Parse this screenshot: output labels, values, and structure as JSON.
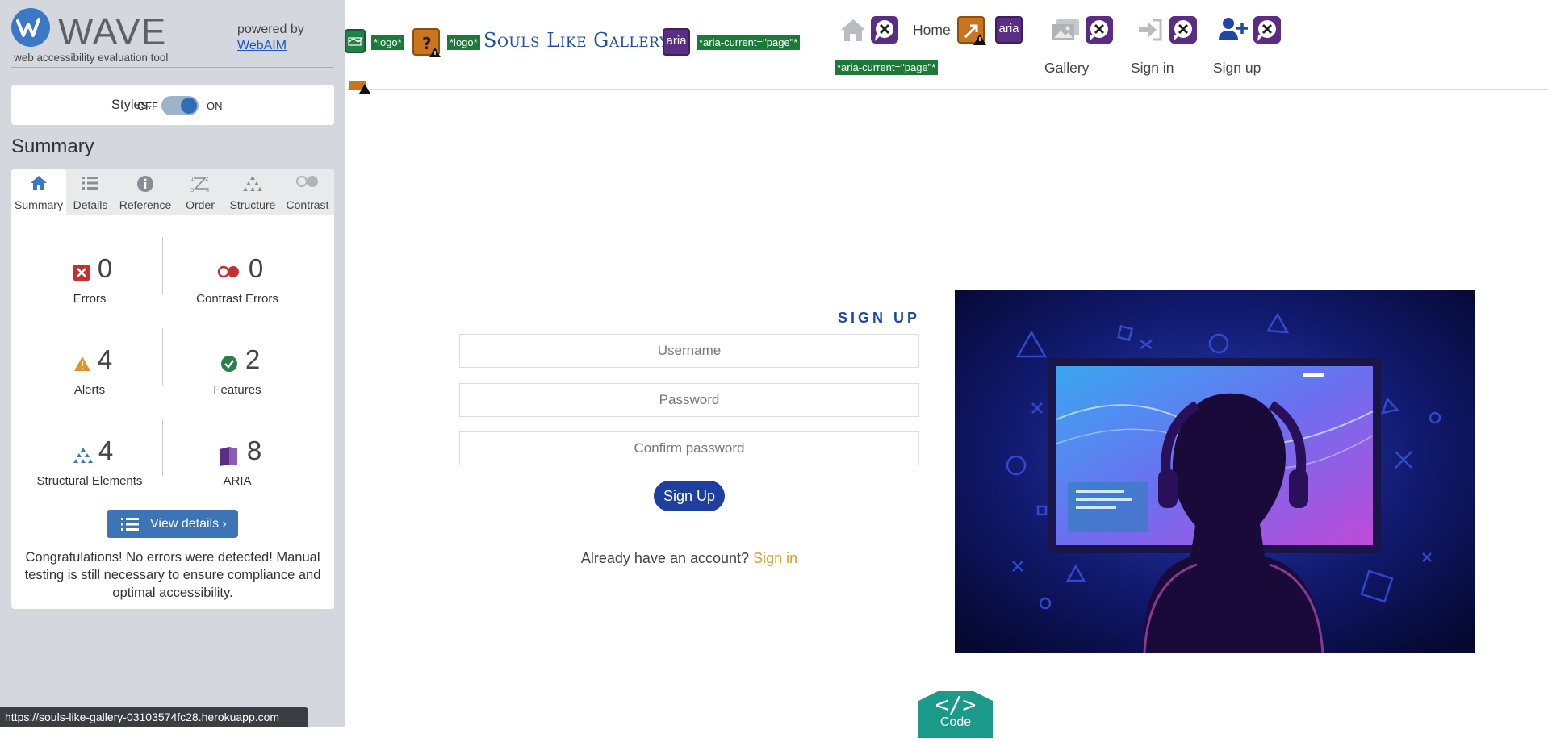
{
  "wave": {
    "wordmark": "WAVE",
    "tagline": "web accessibility evaluation tool",
    "powered_by": "powered by",
    "webaim": "WebAIM",
    "styles": {
      "label": "Styles:",
      "off": "OFF",
      "on": "ON"
    },
    "summary_heading": "Summary",
    "tabs": [
      {
        "label": "Summary",
        "icon": "home-icon"
      },
      {
        "label": "Details",
        "icon": "list-icon"
      },
      {
        "label": "Reference",
        "icon": "info-icon"
      },
      {
        "label": "Order",
        "icon": "order-icon"
      },
      {
        "label": "Structure",
        "icon": "structure-icon"
      },
      {
        "label": "Contrast",
        "icon": "contrast-icon"
      }
    ],
    "stats": {
      "errors": {
        "value": "0",
        "label": "Errors"
      },
      "contrast_errors": {
        "value": "0",
        "label": "Contrast Errors"
      },
      "alerts": {
        "value": "4",
        "label": "Alerts"
      },
      "features": {
        "value": "2",
        "label": "Features"
      },
      "structural": {
        "value": "4",
        "label": "Structural Elements"
      },
      "aria": {
        "value": "8",
        "label": "ARIA"
      }
    },
    "view_details": "View details ›",
    "congrats": "Congratulations! No errors were detected! Manual testing is still necessary to ensure compliance and optimal accessibility."
  },
  "status_bar": {
    "url": "https://souls-like-gallery-03103574fc28.herokuapp.com"
  },
  "navbar": {
    "brand": "Souls Like Gallery",
    "badges": {
      "logo1": "*logo*",
      "logo2": "*logo*",
      "aria_current_1": "*aria-current=\"page\"*",
      "aria_current_2": "*aria-current=\"page\"*",
      "aria": "aria",
      "aria2": "aria"
    },
    "links": {
      "home": "Home",
      "gallery": "Gallery",
      "sign_in": "Sign in",
      "sign_up": "Sign up"
    }
  },
  "form": {
    "title": "SIGN UP",
    "username_placeholder": "Username",
    "password_placeholder": "Password",
    "confirm_placeholder": "Confirm password",
    "submit": "Sign Up",
    "already": "Already have an account?",
    "signin_link": "Sign in"
  },
  "code_button": {
    "symbol": "</>",
    "label": "Code"
  },
  "colors": {
    "wave_blue": "#3b78c6",
    "brand_blue": "#1f4fa8",
    "signin_orange": "#e89a2c",
    "error_red": "#c62f2f",
    "alert_orange": "#e6921e",
    "feature_green": "#2e7d4f",
    "aria_purple": "#5b2e86"
  }
}
